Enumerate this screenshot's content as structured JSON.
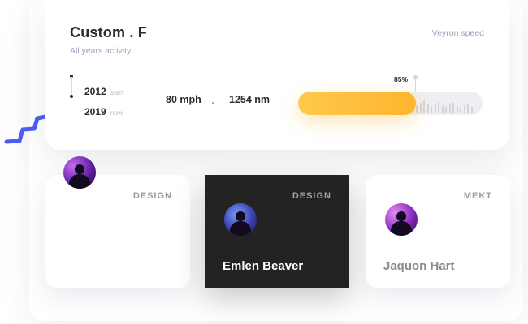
{
  "stats": {
    "title": "Custom . F",
    "subtitle": "All years activity",
    "corner_label": "Veyron speed",
    "timeline": [
      {
        "year": "2012",
        "tag": "start"
      },
      {
        "year": "2019",
        "tag": "now"
      }
    ],
    "speed": "80 mph",
    "torque": "1254 nm",
    "progress_label": "85%",
    "progress_value": 0.64,
    "colors": {
      "accent": "#fdb52f",
      "track": "#efeff2",
      "squiggle": "#4d5cf2"
    }
  },
  "cards": [
    {
      "tag": "DESIGN",
      "name": "",
      "theme": "light"
    },
    {
      "tag": "DESIGN",
      "name": "Emlen Beaver",
      "theme": "dark"
    },
    {
      "tag": "MEKT",
      "name": "Jaquon Hart",
      "theme": "light"
    }
  ]
}
